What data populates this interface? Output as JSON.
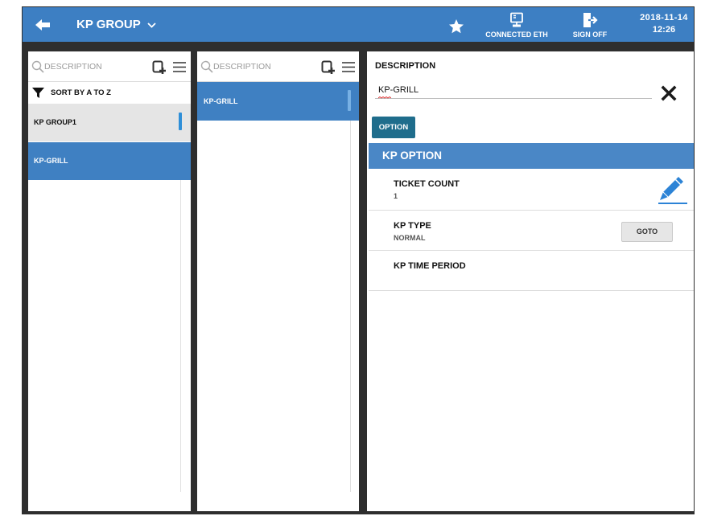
{
  "header": {
    "title": "KP GROUP",
    "connection_label": "CONNECTED ETH",
    "signoff_label": "SIGN OFF",
    "date": "2018-11-14",
    "time": "12:26",
    "icons": {
      "back": "arrow-left-icon",
      "title_menu": "chevron-down-icon",
      "favorite": "star-icon",
      "connection": "ethernet-icon",
      "signoff": "sign-off-icon"
    }
  },
  "groups_panel": {
    "search_placeholder": "DESCRIPTION",
    "sort_label": "SORT BY A TO Z",
    "items": [
      {
        "label": "KP GROUP1",
        "selected": false
      },
      {
        "label": "KP-GRILL",
        "selected": true
      }
    ],
    "icons": {
      "search": "search-icon",
      "add": "add-page-icon",
      "menu": "menu-icon",
      "sort": "funnel-icon"
    }
  },
  "members_panel": {
    "search_placeholder": "DESCRIPTION",
    "items": [
      {
        "label": "KP-GRILL",
        "selected": true
      }
    ],
    "icons": {
      "search": "search-icon",
      "add": "add-page-icon",
      "menu": "menu-icon"
    }
  },
  "detail_panel": {
    "description_label": "DESCRIPTION",
    "description_value": "KP-GRILL",
    "option_tab": "OPTION",
    "section_title": "KP OPTION",
    "fields": [
      {
        "label": "TICKET COUNT",
        "value": "1",
        "icon": "pencil-icon"
      },
      {
        "label": "KP TYPE",
        "value": "NORMAL",
        "button_label": "GOTO"
      },
      {
        "label": "KP TIME PERIOD"
      }
    ],
    "icons": {
      "close": "close-icon"
    }
  },
  "colors": {
    "header": "#3d7fc3",
    "selected_row": "#3f80c2",
    "section_header": "#4a87c6",
    "option_button": "#1f6d8c",
    "pencil": "#2c83d6",
    "frame": "#2e2e2e"
  }
}
